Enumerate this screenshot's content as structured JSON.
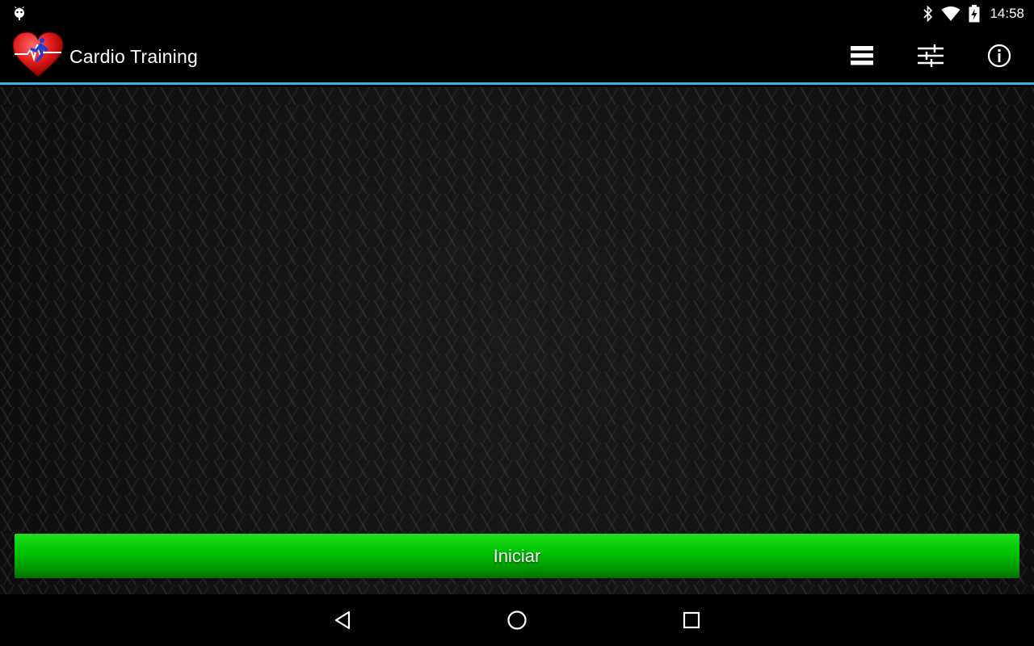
{
  "status_bar": {
    "time": "14:58",
    "icons": [
      "android-debug-icon",
      "bluetooth-icon",
      "wifi-icon",
      "battery-charging-icon"
    ]
  },
  "app_bar": {
    "title": "Cardio Training",
    "logo_icon": "heart-runner-logo",
    "actions": [
      {
        "name": "list-icon"
      },
      {
        "name": "sliders-icon"
      },
      {
        "name": "info-icon"
      }
    ],
    "accent_color": "#33b5e5"
  },
  "main": {
    "start_button_label": "Iniciar",
    "start_button_color": "#00c400"
  },
  "nav_bar": {
    "buttons": [
      "back-icon",
      "home-icon",
      "recents-icon"
    ]
  }
}
